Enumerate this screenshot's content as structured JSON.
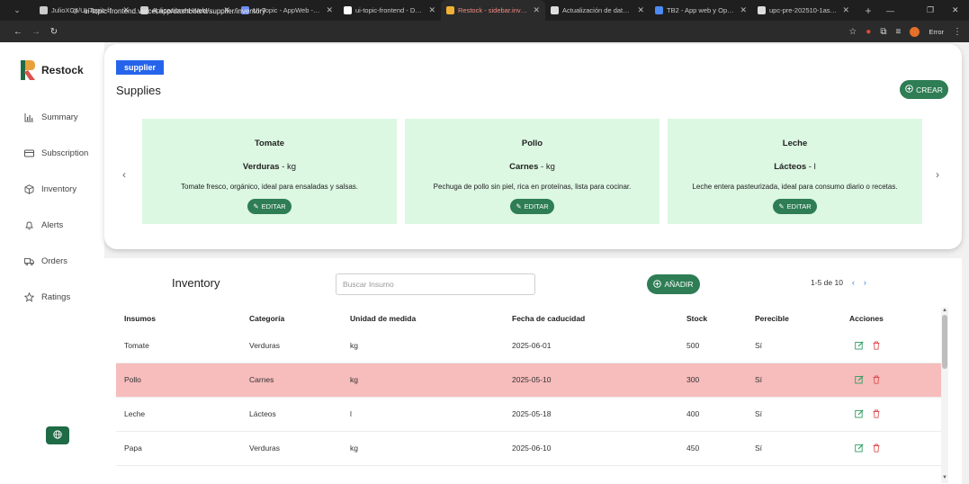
{
  "browser": {
    "tabs": [
      {
        "label": "JulioXC4/UI-Topic-fronte",
        "color": "#cccccc"
      },
      {
        "label": "Aplicaciones-Web-Curso",
        "color": "#cccccc"
      },
      {
        "label": "UI-Topic - AppWeb - Pro",
        "color": "#6d8cf5"
      },
      {
        "label": "ui-topic-frontend - Depl",
        "color": "#ffffff"
      },
      {
        "label": "Restock - sidebar.invento",
        "color": "#f2b134",
        "active": true
      },
      {
        "label": "Actualización de datos u",
        "color": "#dddddd"
      },
      {
        "label": "TB2 - App web y Open So",
        "color": "#4c8bf5"
      },
      {
        "label": "upc-pre-202510-1asi072",
        "color": "#dddddd"
      }
    ],
    "url": "ui-topic-frontend.vercel.app/dashboard/supplier/inventory",
    "error_label": "Error"
  },
  "sidebar": {
    "brand": "Restock",
    "items": [
      {
        "label": "Summary",
        "icon": "bar-chart-icon"
      },
      {
        "label": "Subscription",
        "icon": "credit-card-icon"
      },
      {
        "label": "Inventory",
        "icon": "box-icon"
      },
      {
        "label": "Alerts",
        "icon": "bell-icon"
      },
      {
        "label": "Orders",
        "icon": "truck-icon"
      },
      {
        "label": "Ratings",
        "icon": "star-icon"
      }
    ],
    "language_icon": "globe-icon"
  },
  "supplies": {
    "role_badge": "supplier",
    "title": "Supplies",
    "create_label": "CREAR",
    "edit_label": "EDITAR",
    "items": [
      {
        "name": "Tomate",
        "category": "Verduras",
        "separator": " - ",
        "unit": "kg",
        "description": "Tomate fresco, orgánico, ideal para ensaladas y salsas."
      },
      {
        "name": "Pollo",
        "category": "Carnes",
        "separator": " - ",
        "unit": "kg",
        "description": "Pechuga de pollo sin piel, rica en proteínas, lista para cocinar."
      },
      {
        "name": "Leche",
        "category": "Lácteos",
        "separator": " - ",
        "unit": "l",
        "description": "Leche entera pasteurizada, ideal para consumo diario o recetas."
      }
    ]
  },
  "inventory": {
    "title": "Inventory",
    "search_placeholder": "Buscar Insumo",
    "add_label": "AÑADIR",
    "pagination": "1-5 de 10",
    "columns": [
      "Insumos",
      "Categoría",
      "Unidad de medida",
      "Fecha de caducidad",
      "Stock",
      "Perecible",
      "Acciones"
    ],
    "rows": [
      {
        "insumo": "Tomate",
        "categoria": "Verduras",
        "unidad": "kg",
        "fecha": "2025-06-01",
        "stock": "500",
        "perecible": "Sí",
        "expired": false
      },
      {
        "insumo": "Pollo",
        "categoria": "Carnes",
        "unidad": "kg",
        "fecha": "2025-05-10",
        "stock": "300",
        "perecible": "Sí",
        "expired": true
      },
      {
        "insumo": "Leche",
        "categoria": "Lácteos",
        "unidad": "l",
        "fecha": "2025-05-18",
        "stock": "400",
        "perecible": "Sí",
        "expired": false
      },
      {
        "insumo": "Papa",
        "categoria": "Verduras",
        "unidad": "kg",
        "fecha": "2025-06-10",
        "stock": "450",
        "perecible": "Sí",
        "expired": false
      }
    ]
  },
  "colors": {
    "primary_green": "#2e7d54",
    "card_green": "#dcf7e2",
    "expired_row": "#f7bcbc",
    "badge_blue": "#2563eb"
  }
}
